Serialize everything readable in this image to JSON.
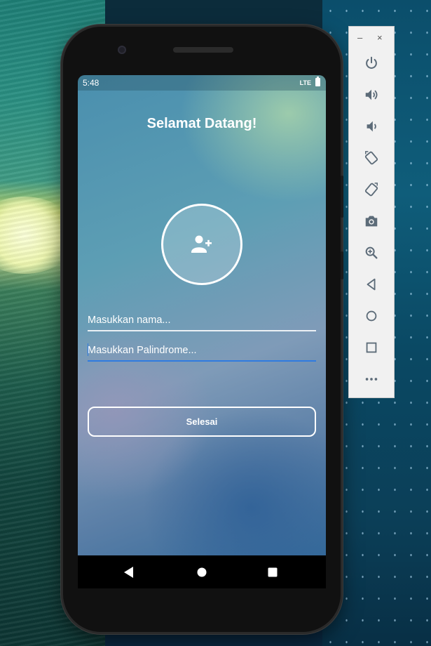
{
  "status": {
    "time": "5:48",
    "network": "LTE"
  },
  "app": {
    "title": "Selamat Datang!",
    "name_placeholder": "Masukkan nama...",
    "palindrome_placeholder": "Masukkan Palindrome...",
    "submit_label": "Selesai"
  },
  "icons": {
    "avatar": "add-user-icon",
    "nav": [
      "back-icon",
      "home-icon",
      "recents-icon"
    ],
    "emulator": [
      "power-icon",
      "volume-up-icon",
      "volume-down-icon",
      "rotate-left-icon",
      "rotate-right-icon",
      "camera-icon",
      "zoom-icon",
      "back-icon",
      "home-icon",
      "overview-icon",
      "more-icon"
    ]
  },
  "emulator": {
    "minimize": "–",
    "close": "×"
  },
  "colors": {
    "accent": "#2f7be0",
    "text": "#ffffff",
    "nav": "#000000"
  }
}
